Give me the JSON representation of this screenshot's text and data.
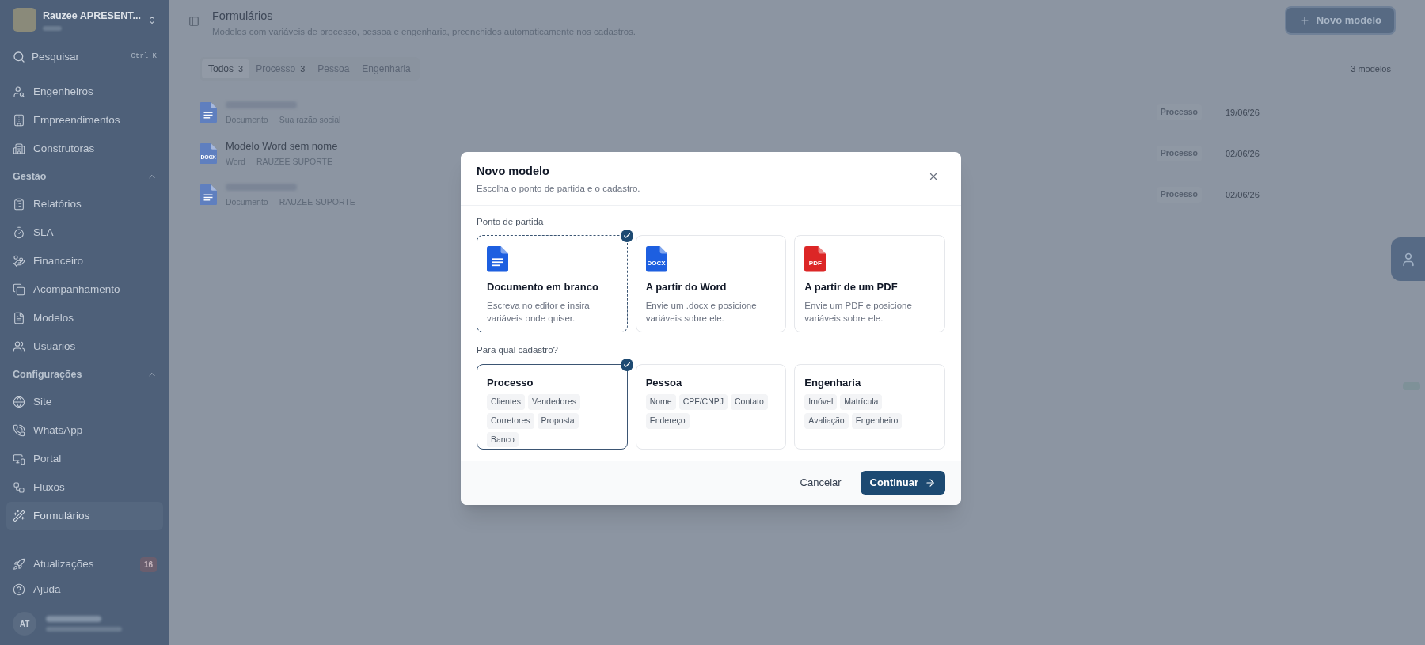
{
  "sidebar": {
    "org": {
      "name": "Rauzee APRESENT..."
    },
    "search": {
      "label": "Pesquisar",
      "shortcut": "Ctrl K"
    },
    "sections": [
      {
        "items": [
          {
            "label": "Engenheiros",
            "selected": false
          },
          {
            "label": "Empreendimentos",
            "selected": false
          },
          {
            "label": "Construtoras",
            "selected": false
          }
        ]
      },
      {
        "title": "Gestão",
        "expanded": true,
        "items": [
          {
            "label": "Relatórios",
            "selected": false
          },
          {
            "label": "SLA",
            "selected": false
          },
          {
            "label": "Financeiro",
            "selected": false
          },
          {
            "label": "Acompanhamento",
            "selected": false
          },
          {
            "label": "Modelos",
            "selected": false
          },
          {
            "label": "Usuários",
            "selected": false
          }
        ]
      },
      {
        "title": "Configurações",
        "expanded": true,
        "items": [
          {
            "label": "Site",
            "selected": false
          },
          {
            "label": "WhatsApp",
            "selected": false
          },
          {
            "label": "Portal",
            "selected": false
          },
          {
            "label": "Fluxos",
            "selected": false
          },
          {
            "label": "Formulários",
            "selected": true
          }
        ]
      }
    ],
    "footer": [
      {
        "label": "Atualizações",
        "badge": "16"
      },
      {
        "label": "Ajuda"
      }
    ],
    "user": {
      "initials": "AT"
    }
  },
  "header": {
    "title": "Formulários",
    "subtitle": "Modelos com variáveis de processo, pessoa e engenharia, preenchidos automaticamente nos cadastros.",
    "new_button": "Novo modelo"
  },
  "tabs": [
    {
      "label": "Todos",
      "count": "3",
      "selected": true
    },
    {
      "label": "Processo",
      "count": "3",
      "selected": false
    },
    {
      "label": "Pessoa",
      "selected": false
    },
    {
      "label": "Engenharia",
      "selected": false
    }
  ],
  "total": "3 modelos",
  "rows": [
    {
      "kind": "doc",
      "type": "Documento",
      "owner": "Sua razão social",
      "tag": "Processo",
      "date": "19/06/26"
    },
    {
      "kind": "word",
      "icon_text": "DOCX",
      "title": "Modelo Word sem nome",
      "type": "Word",
      "owner": "RAUZEE SUPORTE",
      "tag": "Processo",
      "date": "02/06/26"
    },
    {
      "kind": "doc",
      "type": "Documento",
      "owner": "RAUZEE SUPORTE",
      "tag": "Processo",
      "date": "02/06/26"
    }
  ],
  "modal": {
    "title": "Novo modelo",
    "subtitle": "Escolha o ponto de partida e o cadastro.",
    "start": {
      "label": "Ponto de partida",
      "options": [
        {
          "kind": "blank",
          "title": "Documento em branco",
          "description": "Escreva no editor e insira variáveis onde quiser.",
          "selected": true
        },
        {
          "kind": "word",
          "icon_text": "DOCX",
          "title": "A partir do Word",
          "description": "Envie um .docx e posicione variáveis sobre ele.",
          "selected": false
        },
        {
          "kind": "pdf",
          "icon_text": "PDF",
          "title": "A partir de um PDF",
          "description": "Envie um PDF e posicione variáveis sobre ele.",
          "selected": false
        }
      ]
    },
    "target": {
      "label": "Para qual cadastro?",
      "options": [
        {
          "title": "Processo",
          "fields": [
            "Clientes",
            "Vendedores",
            "Corretores",
            "Proposta",
            "Banco"
          ],
          "selected": true
        },
        {
          "title": "Pessoa",
          "fields": [
            "Nome",
            "CPF/CNPJ",
            "Contato",
            "Endereço"
          ],
          "selected": false
        },
        {
          "title": "Engenharia",
          "fields": [
            "Imóvel",
            "Matrícula",
            "Avaliação",
            "Engenheiro"
          ],
          "selected": false
        }
      ]
    },
    "cancel": "Cancelar",
    "continue": "Continuar"
  }
}
